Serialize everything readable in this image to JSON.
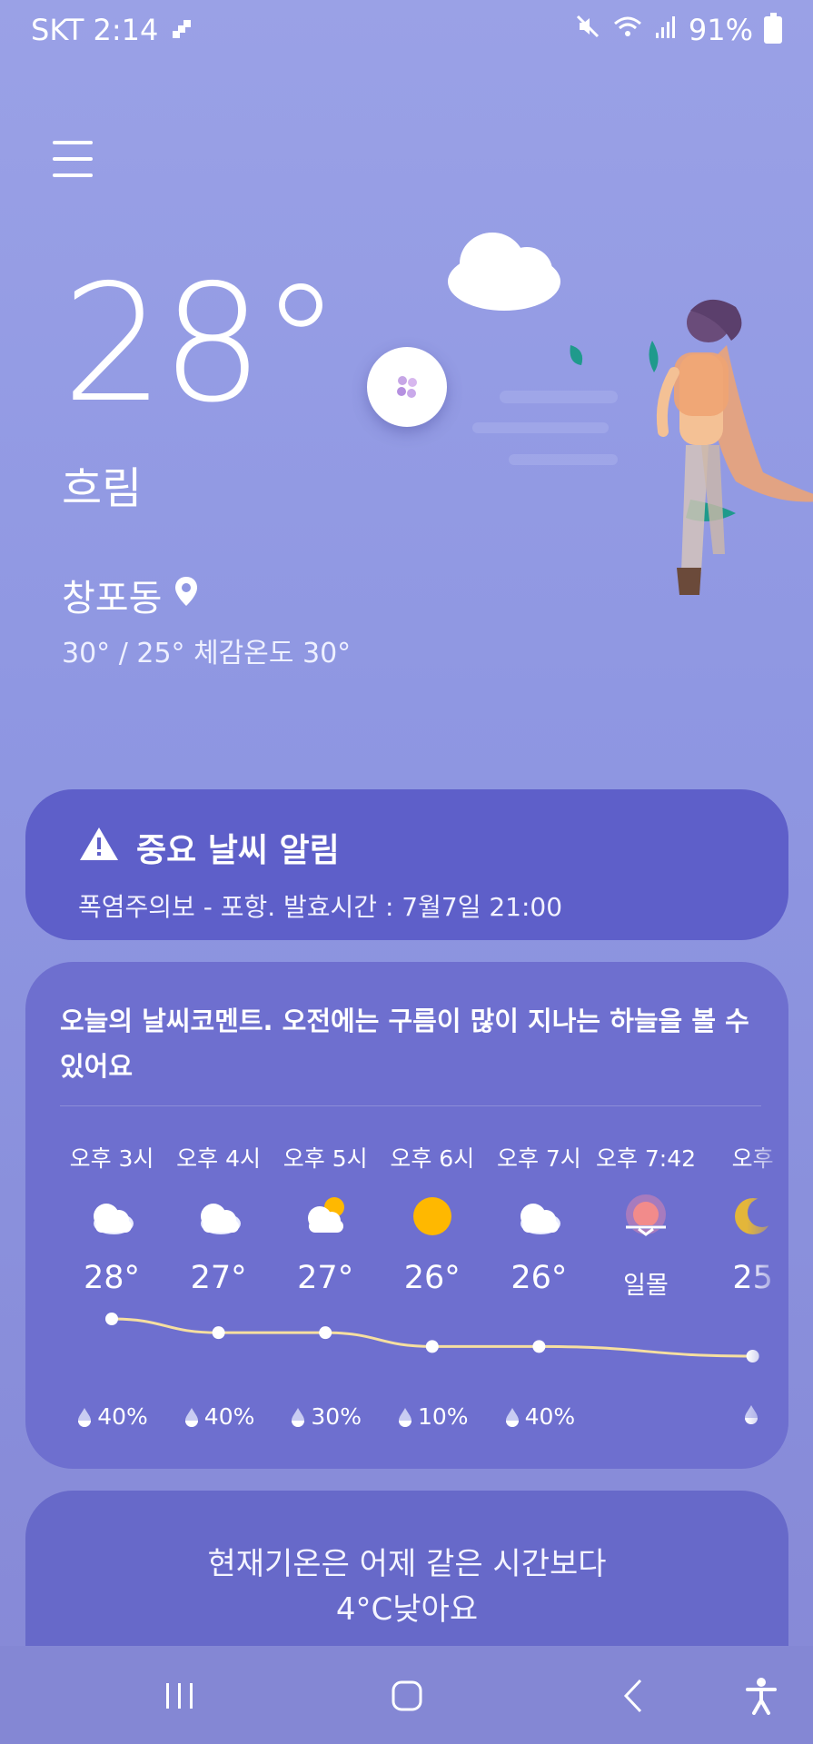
{
  "status": {
    "carrier_time": "SKT 2:14",
    "battery": "91%"
  },
  "current": {
    "temperature": "28°",
    "condition": "흐림",
    "location": "창포동",
    "hi_lo_feels": "30° / 25° 체감온도 30°"
  },
  "alert": {
    "title": "중요 날씨 알림",
    "body": "폭염주의보 - 포항. 발효시간 : 7월7일 21:00"
  },
  "forecast": {
    "comment": "오늘의 날씨코멘트. 오전에는 구름이 많이 지나는 하늘을 볼 수 있어요",
    "hours": [
      {
        "time": "오후 3시",
        "icon": "cloudy-icon",
        "temp": "28°",
        "temp_value": 28,
        "rain": "40%"
      },
      {
        "time": "오후 4시",
        "icon": "cloudy-icon",
        "temp": "27°",
        "temp_value": 27,
        "rain": "40%"
      },
      {
        "time": "오후 5시",
        "icon": "partly-cloudy-icon",
        "temp": "27°",
        "temp_value": 27,
        "rain": "30%"
      },
      {
        "time": "오후 6시",
        "icon": "sun-icon",
        "temp": "26°",
        "temp_value": 26,
        "rain": "10%"
      },
      {
        "time": "오후 7시",
        "icon": "cloudy-icon",
        "temp": "26°",
        "temp_value": 26,
        "rain": "40%"
      },
      {
        "time": "오후 7:42",
        "icon": "sunset-icon",
        "label": "일몰"
      },
      {
        "time": "오후",
        "icon": "moon-icon",
        "temp": "25",
        "temp_value": 25.3,
        "rain": ""
      }
    ]
  },
  "comparison": {
    "line1": "현재기온은 어제 같은 시간보다",
    "line2": "4°C낮아요"
  },
  "colors": {
    "background": "#9aa1e6",
    "alert_card": "#5e5fc9",
    "forecast_card": "#6e6fcf",
    "temp_line": "#f6dfa0",
    "sun": "#ffb800"
  }
}
